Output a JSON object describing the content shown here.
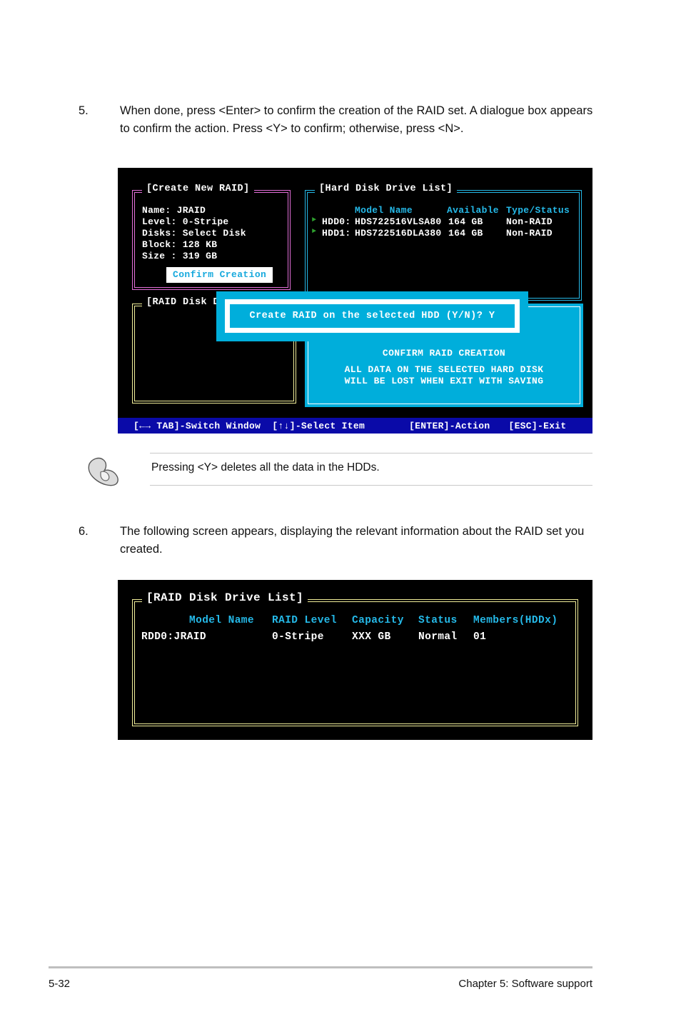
{
  "page": {
    "footer_left": "5-32",
    "footer_right": "Chapter 5: Software support"
  },
  "steps": [
    {
      "number": "5.",
      "text": "When done, press <Enter> to confirm the creation of the RAID set. A dialogue box appears to confirm the action. Press <Y> to confirm; otherwise, press <N>."
    },
    {
      "number": "6.",
      "text": "The following screen appears, displaying the relevant information about the RAID set you created."
    }
  ],
  "note": {
    "icon": "pointing-hand-icon",
    "text": "Pressing <Y> deletes all the data in the HDDs."
  },
  "screen1": {
    "create_new_raid": {
      "title": "[Create New RAID]",
      "border_color": "#e26fd8",
      "fields": [
        "Name: JRAID",
        "Level: 0-Stripe",
        "Disks: Select Disk",
        "Block: 128 KB",
        "Size : 319 GB"
      ],
      "button": "Confirm Creation",
      "button_color": "#17a9dd"
    },
    "hard_disk_drive_list": {
      "title": "[Hard Disk Drive List]",
      "border_color": "#25b9e8",
      "columns": [
        "Model Name",
        "Available",
        "Type/Status"
      ],
      "rows": [
        {
          "bullet": "►",
          "id": "HDD0:",
          "model": "HDS722516VLSA80",
          "available": "164 GB",
          "type": "Non-RAID"
        },
        {
          "bullet": "►",
          "id": "HDD1:",
          "model": "HDS722516DLA380",
          "available": "164 GB",
          "type": "Non-RAID"
        }
      ]
    },
    "raid_disk_drive_list": {
      "title": "[RAID Disk Dr",
      "border_color": "#f2ef9a"
    },
    "help_panel": {
      "background": "#00aedb",
      "heading": "CONFIRM RAID CREATION",
      "line1": "ALL DATA ON THE SELECTED HARD DISK",
      "line2": "WILL BE LOST WHEN EXIT WITH SAVING"
    },
    "dialogue": {
      "background": "#00aedb",
      "text": "Create RAID on the selected HDD (Y/N)? Y"
    },
    "statusbar": {
      "background": "#0a0aa8",
      "left": "[←→ TAB]-Switch Window  [↑↓]-Select Item",
      "action": "[ENTER]-Action",
      "exit": "[ESC]-Exit"
    }
  },
  "screen2": {
    "raid_disk_drive_list": {
      "title": "[RAID Disk Drive List]",
      "border_color": "#f2ef9a",
      "columns": [
        "Model Name",
        "RAID Level",
        "Capacity",
        "Status",
        "Members(HDDx)"
      ],
      "rows": [
        {
          "id": "RDD0:JRAID",
          "level": "0-Stripe",
          "capacity": "XXX GB",
          "status": "Normal",
          "members": "01"
        }
      ]
    }
  }
}
